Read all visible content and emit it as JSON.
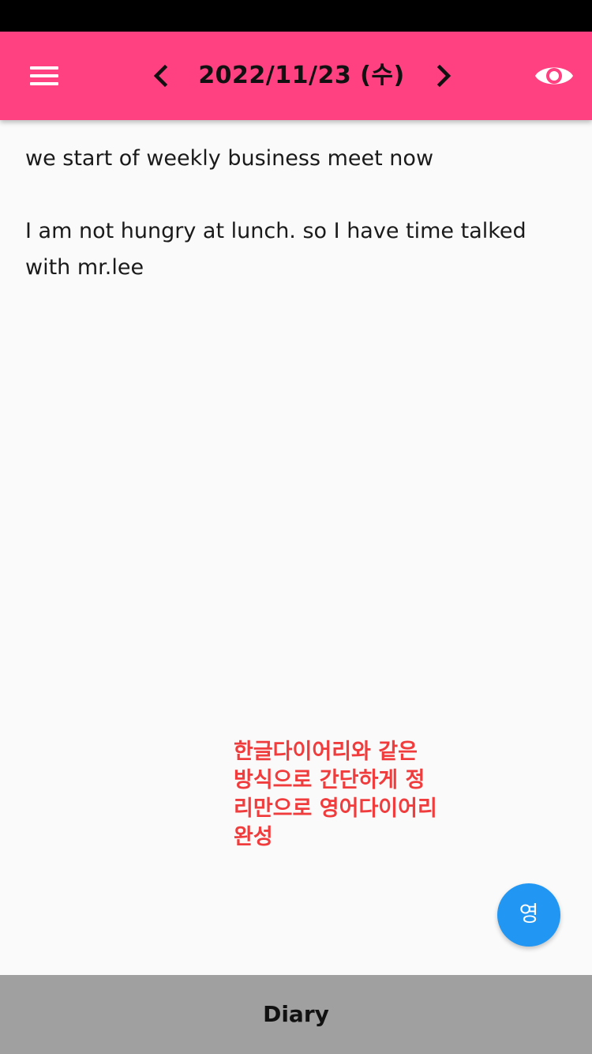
{
  "header": {
    "date_title": "2022/11/23 (수)",
    "background_color": "#ff4081",
    "menu_icon": "hamburger-menu-icon",
    "prev_icon": "chevron-left-icon",
    "next_icon": "chevron-right-icon",
    "visibility_icon": "eye-icon"
  },
  "diary": {
    "paragraphs": [
      [
        "we start of weekly business meet now"
      ],
      [
        "I am not hungry at lunch. so I have time talked",
        "with mr.lee"
      ]
    ]
  },
  "annotation": {
    "text": "한글다이어리와 같은 방식으로 간단하게 정리만으로 영어다이어리 완성",
    "color": "#f03c3c"
  },
  "fab": {
    "label": "영",
    "color": "#2196f3"
  },
  "bottom_nav": {
    "tab_label": "Diary"
  }
}
